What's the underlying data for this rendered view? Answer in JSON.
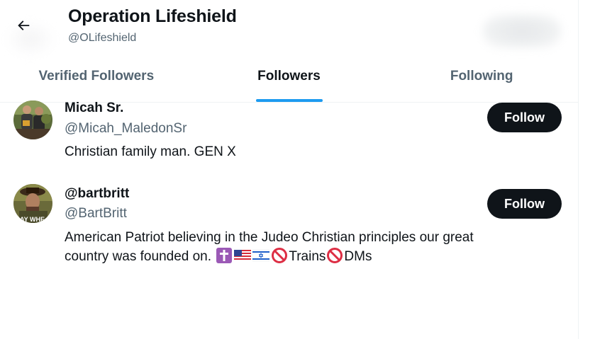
{
  "header": {
    "title": "Operation Lifeshield",
    "handle": "@OLifeshield"
  },
  "tabs": [
    {
      "label": "Verified Followers",
      "active": false
    },
    {
      "label": "Followers",
      "active": true
    },
    {
      "label": "Following",
      "active": false
    }
  ],
  "users": [
    {
      "name": "Micah Sr.",
      "handle": "@Micah_MaledonSr",
      "bio": "Christian family man. GEN X",
      "button": "Follow"
    },
    {
      "name": "@bartbritt",
      "handle": "@BartBritt",
      "bio_line1": "American Patriot believing in the Judeo Christian principles our great",
      "bio_line2_prefix": "country was founded on.",
      "bio_trains": "Trains",
      "bio_dms": "DMs",
      "avatar_caption": "SAY WHE",
      "button": "Follow"
    }
  ],
  "icons": {
    "back": "arrow-left-icon",
    "cross": "latin-cross-emoji",
    "us_flag": "us-flag-emoji",
    "il_flag": "israel-flag-emoji",
    "prohibited": "prohibited-emoji"
  },
  "colors": {
    "accent": "#1d9bf0",
    "text": "#0f1419",
    "secondary": "#536471",
    "button_bg": "#0f1419"
  }
}
